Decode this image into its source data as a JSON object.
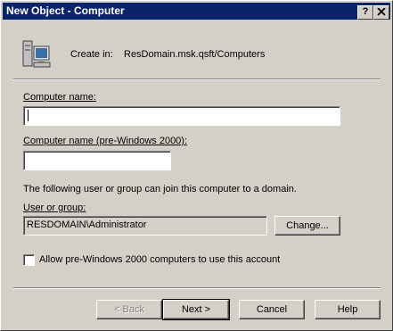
{
  "window": {
    "title": "New Object - Computer",
    "help_button": "?",
    "close_button": "X"
  },
  "header": {
    "icon": "computer-icon",
    "create_in_label": "Create in:",
    "create_in_value": "ResDomain.msk.qsft/Computers"
  },
  "form": {
    "computer_name_label": "Computer name:",
    "computer_name_value": "",
    "pre2000_label": "Computer name (pre-Windows 2000):",
    "pre2000_value": "",
    "join_text": "The following user or group can join this computer to a domain.",
    "user_group_label": "User or group:",
    "user_group_value": "RESDOMAIN\\Administrator",
    "change_button": "Change...",
    "allow_checkbox_label": "Allow pre-Windows 2000 computers to use this account",
    "allow_checkbox_checked": false
  },
  "footer": {
    "back_button": "< Back",
    "next_button": "Next >",
    "cancel_button": "Cancel",
    "help_button": "Help"
  }
}
